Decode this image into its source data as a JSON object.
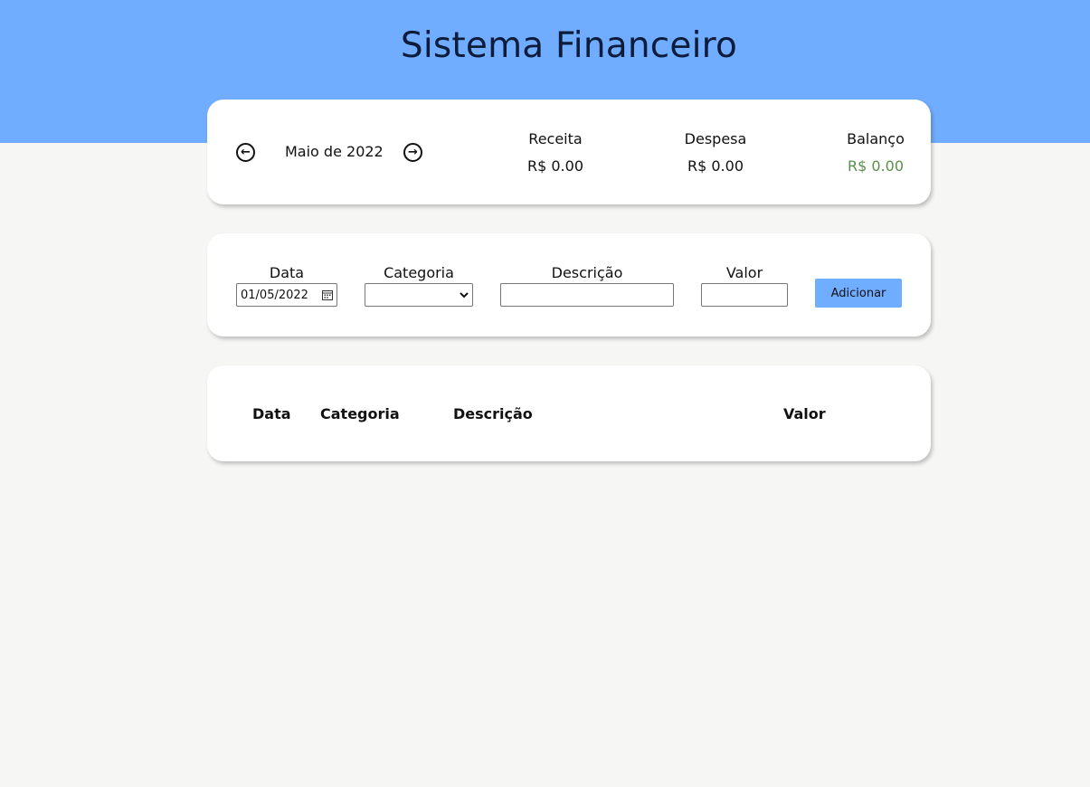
{
  "header": {
    "title": "Sistema Financeiro"
  },
  "summary": {
    "month_label": "Maio de 2022",
    "prev_icon": "arrow-left-circle-icon",
    "next_icon": "arrow-right-circle-icon",
    "receita": {
      "title": "Receita",
      "value": "R$ 0.00"
    },
    "despesa": {
      "title": "Despesa",
      "value": "R$ 0.00"
    },
    "balanco": {
      "title": "Balanço",
      "value": "R$ 0.00",
      "color": "#5a8f4a"
    }
  },
  "form": {
    "data": {
      "label": "Data",
      "value": "01/05/2022"
    },
    "categoria": {
      "label": "Categoria",
      "value": ""
    },
    "descricao": {
      "label": "Descrição",
      "value": ""
    },
    "valor": {
      "label": "Valor",
      "value": ""
    },
    "add_label": "Adicionar"
  },
  "table": {
    "columns": [
      "Data",
      "Categoria",
      "Descrição",
      "Valor"
    ],
    "rows": []
  },
  "colors": {
    "accent": "#70acff",
    "background": "#f6f6f5",
    "title": "#0e1c3c"
  }
}
